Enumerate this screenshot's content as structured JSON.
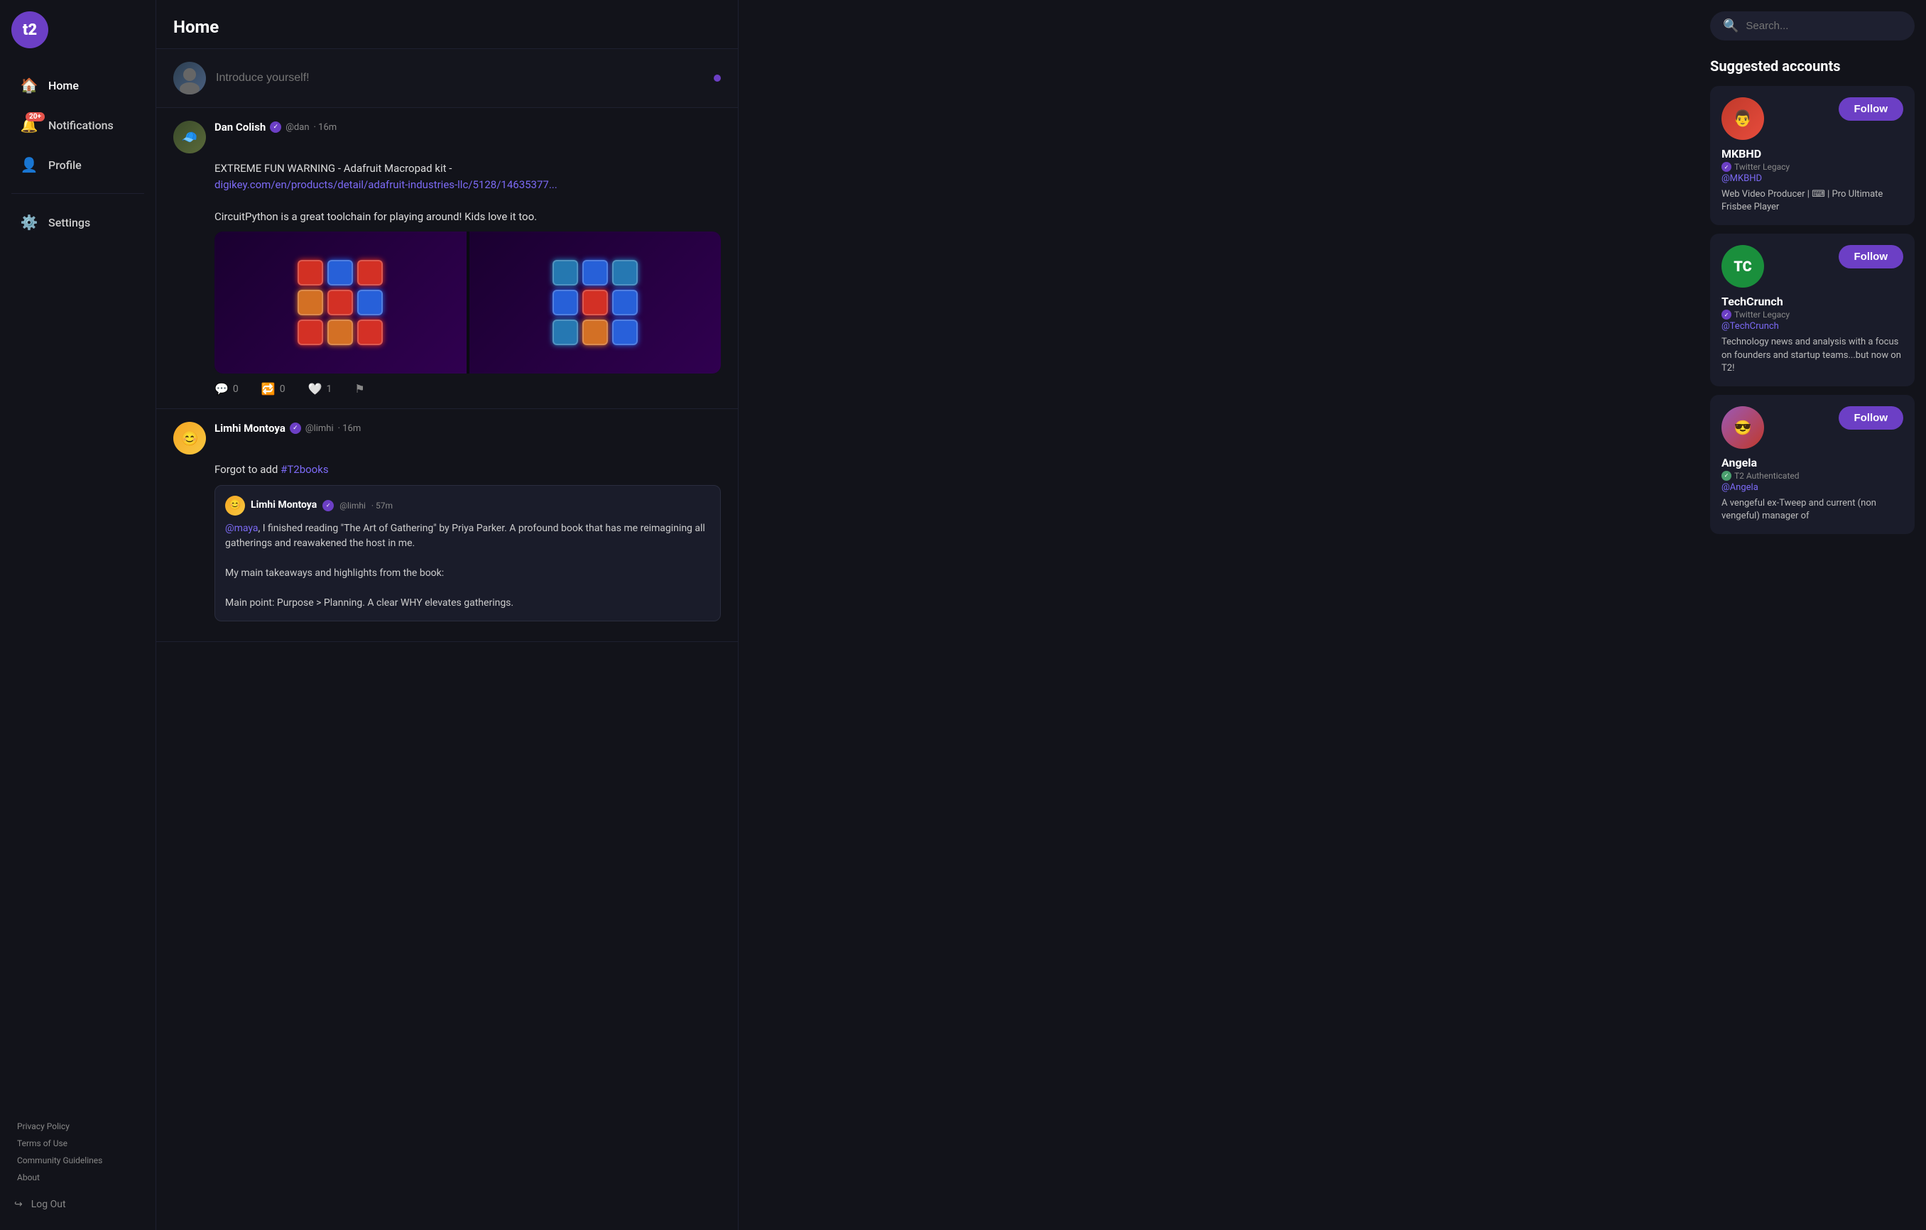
{
  "app": {
    "logo": "t2",
    "title": "Home"
  },
  "sidebar": {
    "nav": [
      {
        "id": "home",
        "label": "Home",
        "icon": "🏠",
        "active": true
      },
      {
        "id": "notifications",
        "label": "Notifications",
        "icon": "🔔",
        "badge": "20+"
      },
      {
        "id": "profile",
        "label": "Profile",
        "icon": "👤"
      },
      {
        "id": "settings",
        "label": "Settings",
        "icon": "⚙️"
      }
    ],
    "footer_links": [
      {
        "label": "Privacy Policy"
      },
      {
        "label": "Terms of Use"
      },
      {
        "label": "Community Guidelines"
      },
      {
        "label": "About"
      }
    ],
    "logout_label": "Log Out"
  },
  "compose": {
    "placeholder": "Introduce yourself!"
  },
  "posts": [
    {
      "id": "post1",
      "author": "Dan Colish",
      "handle": "@dan",
      "time": "16m",
      "verified": true,
      "body_line1": "EXTREME FUN WARNING - Adafruit Macropad kit -",
      "link_text": "digikey.com/en/products/detail/adafruit-industries-llc/5128/14635377...",
      "body_line2": "CircuitPython is a great toolchain for playing around! Kids love it too.",
      "has_images": true,
      "comment_count": "0",
      "repost_count": "0",
      "like_count": "1"
    },
    {
      "id": "post2",
      "author": "Limhi Montoya",
      "handle": "@limhi",
      "time": "16m",
      "verified": true,
      "body": "Forgot to add #T2books",
      "hashtag": "#T2books",
      "quoted": {
        "author": "Limhi Montoya",
        "handle": "@limhi",
        "time": "57m",
        "verified": true,
        "mention": "@maya",
        "body_prefix": ", I finished reading \"The Art of Gathering\" by Priya Parker. A profound book that has me reimagining all gatherings and reawakened the host in me.",
        "body2": "My main takeaways and highlights from the book:",
        "body3": "Main point: Purpose > Planning. A clear WHY elevates gatherings."
      }
    }
  ],
  "right_sidebar": {
    "search_placeholder": "Search...",
    "suggested_title": "Suggested accounts",
    "accounts": [
      {
        "id": "mkbhd",
        "name": "MKBHD",
        "badge_type": "Twitter Legacy",
        "badge_style": "purple",
        "handle": "@MKBHD",
        "bio": "Web Video Producer | ⌨ | Pro Ultimate Frisbee Player",
        "follow_label": "Follow"
      },
      {
        "id": "techcrunch",
        "name": "TechCrunch",
        "badge_type": "Twitter Legacy",
        "badge_style": "purple",
        "handle": "@TechCrunch",
        "bio": "Technology news and analysis with a focus on founders and startup teams...but now on T2!",
        "follow_label": "Follow"
      },
      {
        "id": "angela",
        "name": "Angela",
        "badge_type": "T2 Authenticated",
        "badge_style": "t2",
        "handle": "@Angela",
        "bio": "A vengeful ex-Tweep and current (non vengeful) manager of",
        "follow_label": "Follow"
      }
    ]
  }
}
